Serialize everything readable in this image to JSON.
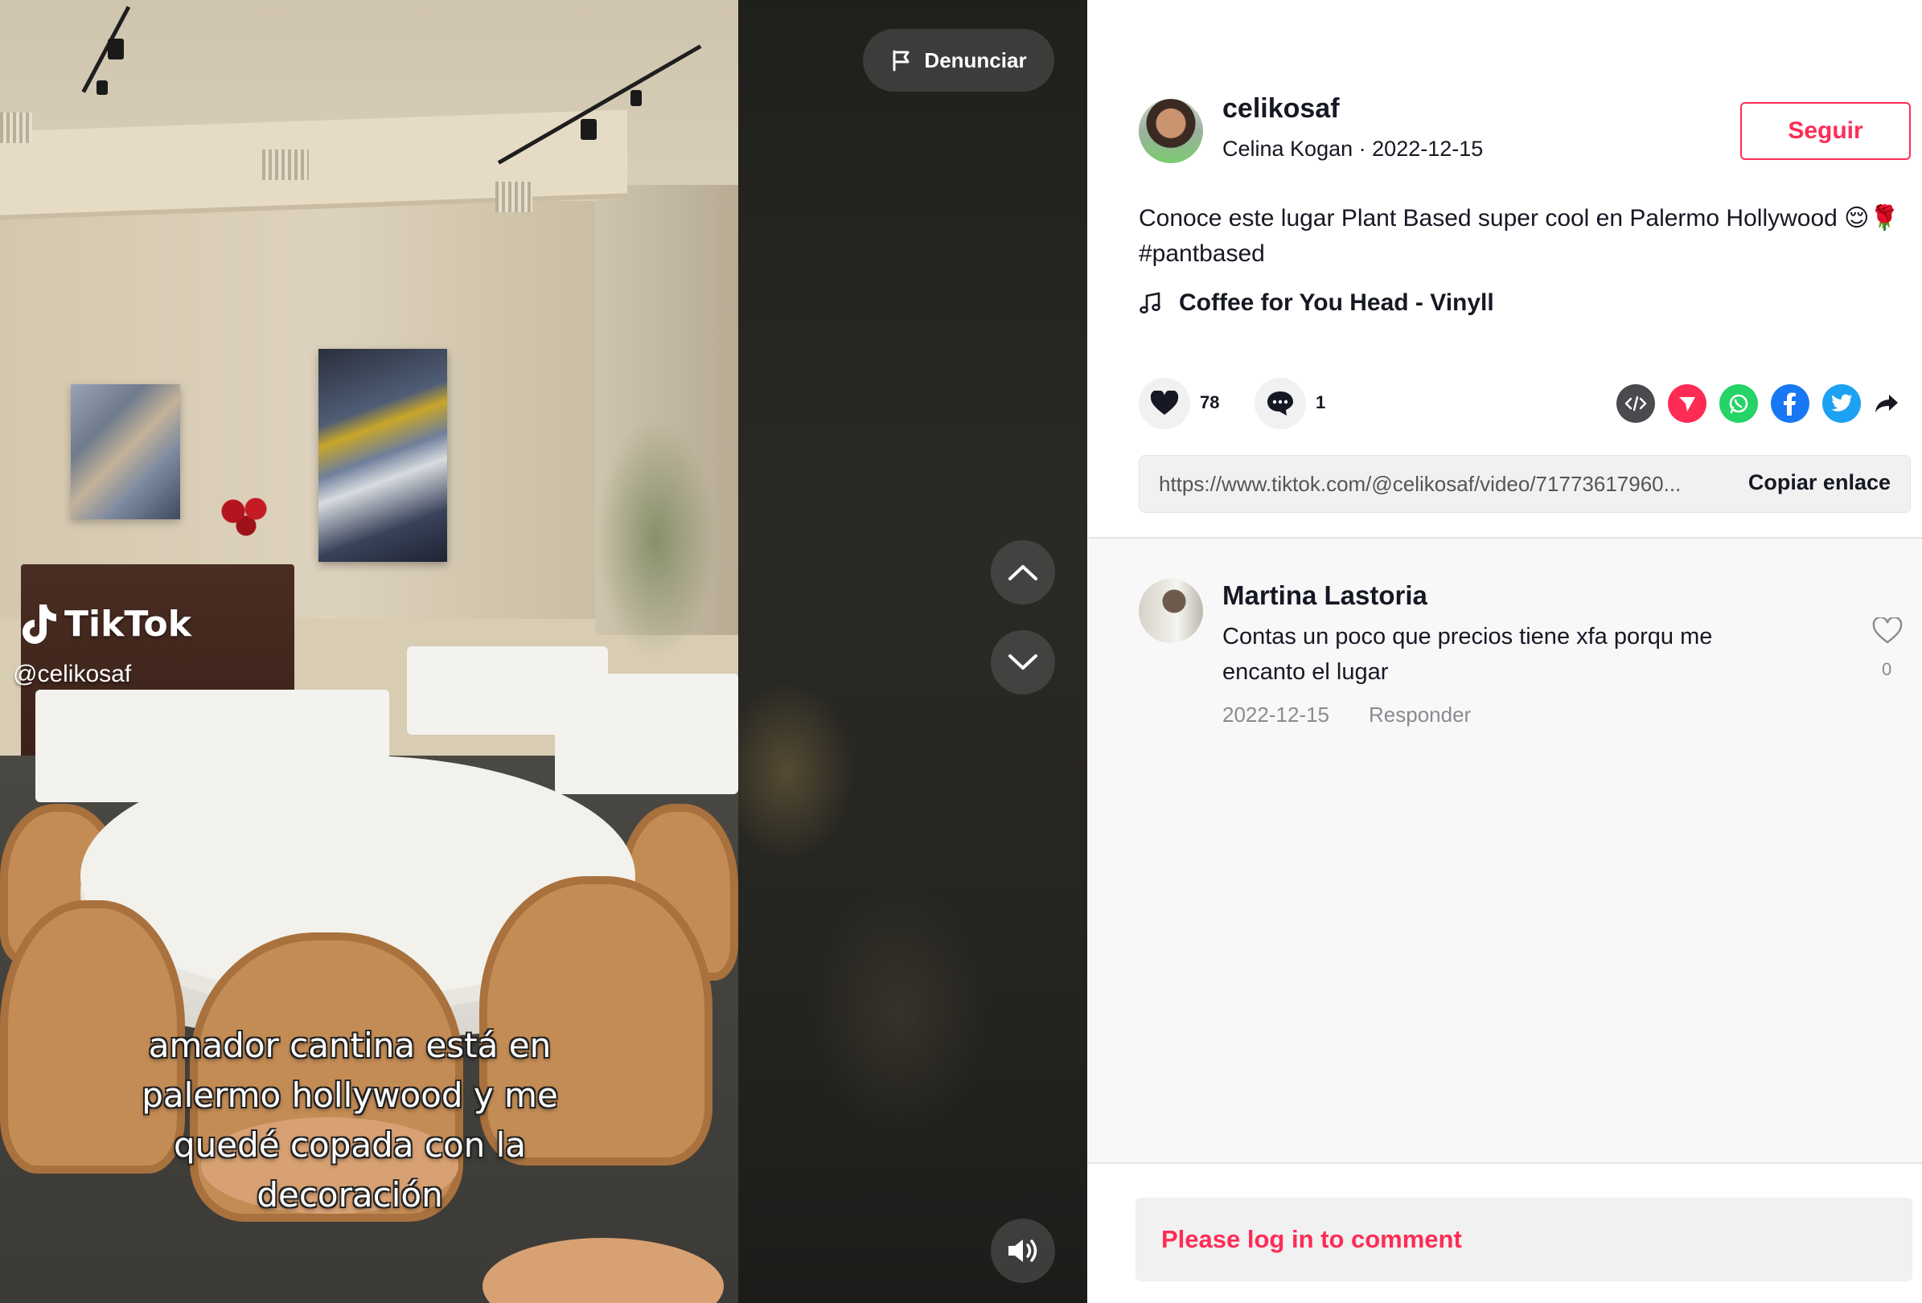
{
  "video": {
    "watermark_brand": "TikTok",
    "watermark_handle": "@celikosaf",
    "caption_lines": [
      "amador cantina está en",
      "palermo hollywood y me",
      "quedé copada con la",
      "decoración"
    ],
    "report_label": "Denunciar",
    "icons": {
      "report": "flag-icon",
      "prev": "chevron-up-icon",
      "next": "chevron-down-icon",
      "volume": "volume-icon"
    }
  },
  "author": {
    "username": "celikosaf",
    "display_name": "Celina Kogan",
    "date": "2022-12-15",
    "meta_separator": "·",
    "follow_label": "Seguir"
  },
  "post": {
    "description": "Conoce este lugar Plant Based super cool en Palermo Hollywood 😌🌹 #pantbased",
    "music": "Coffee for You Head - Vinyll"
  },
  "actions": {
    "likes": "78",
    "comments": "1",
    "share_icons": [
      "embed-icon",
      "send-icon",
      "whatsapp-icon",
      "facebook-icon",
      "twitter-icon",
      "share-arrow-icon"
    ]
  },
  "link": {
    "url": "https://www.tiktok.com/@celikosaf/video/71773617960...",
    "copy_label": "Copiar enlace"
  },
  "comments": [
    {
      "name": "Martina Lastoria",
      "text": "Contas un poco que precios tiene xfa porqu me encanto el lugar",
      "date": "2022-12-15",
      "reply_label": "Responder",
      "likes": "0"
    }
  ],
  "login_prompt": "Please log in to comment",
  "colors": {
    "accent": "#fe2c55",
    "embed": "#4a4a4f",
    "send": "#fe2c55",
    "whatsapp": "#25d366",
    "facebook": "#1877f2",
    "twitter": "#1da1f2"
  }
}
